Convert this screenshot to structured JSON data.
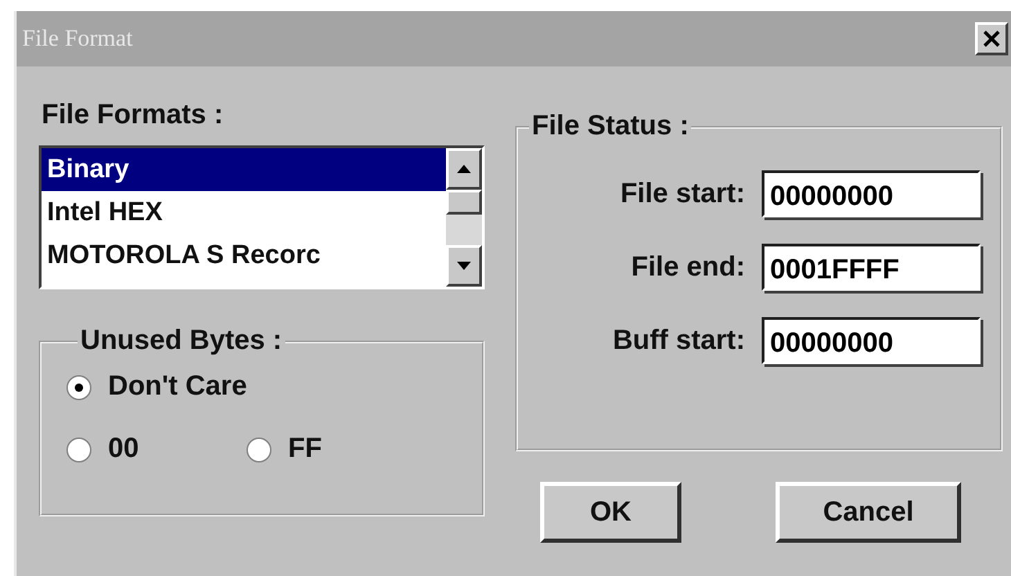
{
  "window": {
    "title": "File Format"
  },
  "file_formats": {
    "label": "File Formats :",
    "items": [
      {
        "label": "Binary",
        "selected": true
      },
      {
        "label": "Intel HEX",
        "selected": false
      },
      {
        "label": "MOTOROLA S Recorc",
        "selected": false
      }
    ]
  },
  "unused_bytes": {
    "label": "Unused Bytes :",
    "options": [
      {
        "label": "Don't Care",
        "selected": true
      },
      {
        "label": "00",
        "selected": false
      },
      {
        "label": "FF",
        "selected": false
      }
    ]
  },
  "file_status": {
    "label": "File Status :",
    "fields": [
      {
        "label": "File start:",
        "value": "00000000"
      },
      {
        "label": "File end:",
        "value": "0001FFFF"
      },
      {
        "label": "Buff start:",
        "value": "00000000"
      }
    ]
  },
  "buttons": [
    "OK",
    "Cancel"
  ]
}
